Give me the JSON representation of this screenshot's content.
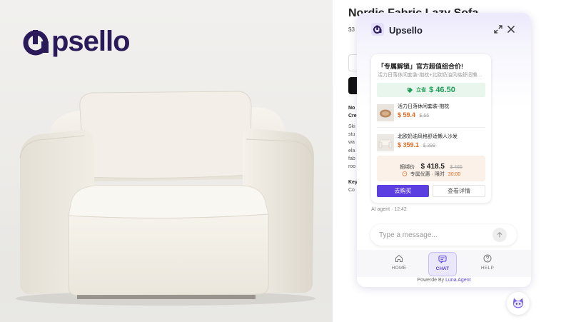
{
  "hero": {
    "logo_text": "psello",
    "logo_letter": "U"
  },
  "product": {
    "title": "Nordic Fabric Lazy Sofa",
    "price": "$3",
    "desc_heading": [
      "No",
      "Cre"
    ],
    "desc_lines": [
      "Ski",
      "stu",
      "wa",
      "ela",
      "fab",
      "roo"
    ],
    "key_heading": "Key",
    "key_line": "Co"
  },
  "widget": {
    "title": "Upsello",
    "card": {
      "title": "「专属解锁」官方超值组合价!",
      "subtitle": "活力日落休闲套装-抱枕+北欧奶油风格舒适懒人沙发",
      "save_label": "立省",
      "save_price": "$ 46.50",
      "items": [
        {
          "name": "活力日落休闲套装-抱枕",
          "price": "$ 59.4",
          "old_price": "$ 66"
        },
        {
          "name": "北欧奶油风格舒适懒人沙发",
          "price": "$ 359.1",
          "old_price": "$ 399"
        }
      ],
      "bundle_label": "捆绑价",
      "bundle_price": "$ 418.5",
      "bundle_old": "$ 465",
      "offer_label": "专属优惠 · 限时",
      "offer_timer": "30:00",
      "buy_label": "去购买",
      "detail_label": "查看详情"
    },
    "agent_meta": "AI agent · 12:42",
    "input_placeholder": "Type a message...",
    "nav": [
      {
        "label": "HOME",
        "icon": "home-icon"
      },
      {
        "label": "CHAT",
        "icon": "chat-icon"
      },
      {
        "label": "HELP",
        "icon": "help-icon"
      }
    ],
    "footer_prefix": "Powerde By",
    "footer_brand": "Luna Agent"
  },
  "colors": {
    "brand_purple": "#5b3fe0",
    "logo_navy": "#2b1a5a",
    "save_green": "#1f9d57",
    "price_orange": "#e56a24"
  }
}
